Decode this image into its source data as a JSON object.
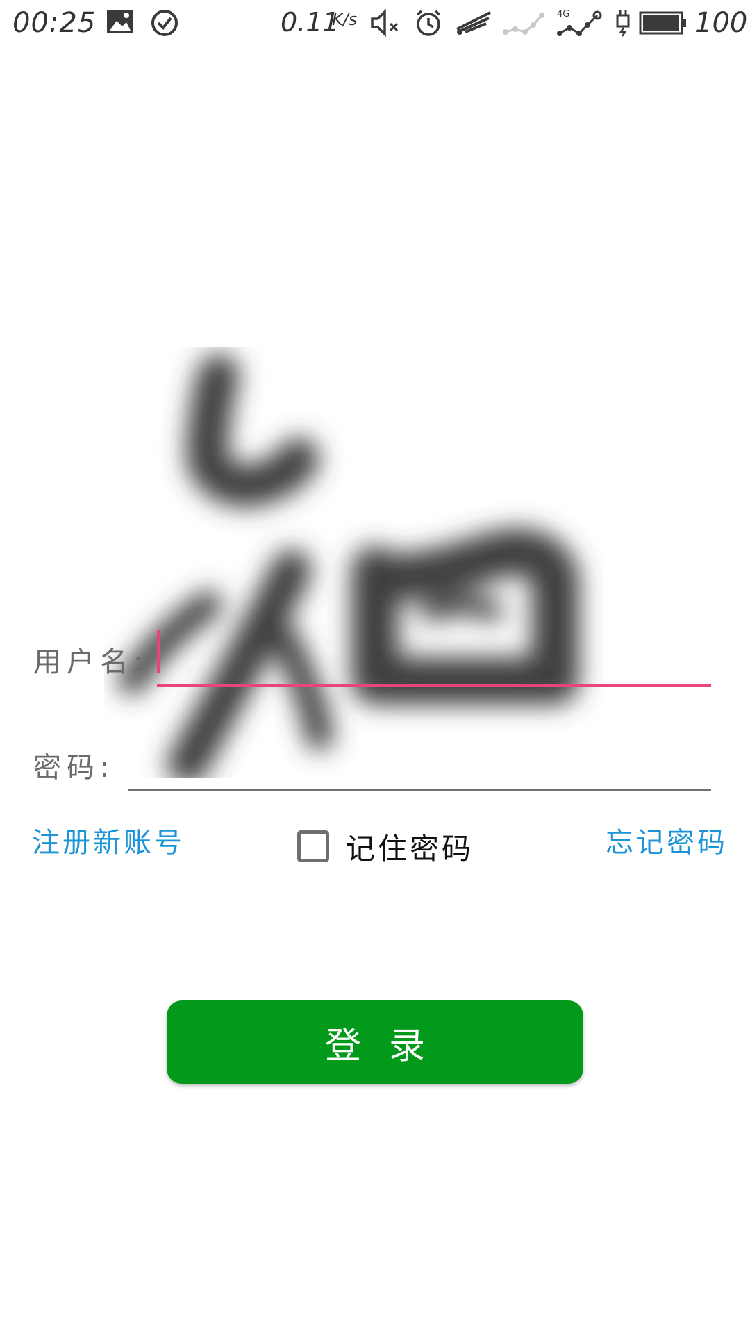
{
  "status_bar": {
    "time": "00:25",
    "net_speed": "0.11",
    "net_speed_unit": "K/s",
    "battery_level": "100",
    "icons": [
      "gallery-icon",
      "check-circle-icon",
      "mute-icon",
      "alarm-icon",
      "wifi-icon",
      "signal-1-icon",
      "signal-4g-icon",
      "charging-icon",
      "battery-icon"
    ],
    "network_type": "4G"
  },
  "form": {
    "username_label": "用户名:",
    "username_value": "",
    "password_label": "密码:",
    "password_value": "",
    "register_link": "注册新账号",
    "remember_label": "记住密码",
    "remember_checked": false,
    "forgot_link": "忘记密码",
    "login_button": "登录"
  },
  "colors": {
    "accent_pink": "#e8457a",
    "link_blue": "#1a94d6",
    "button_green": "#03991a"
  }
}
